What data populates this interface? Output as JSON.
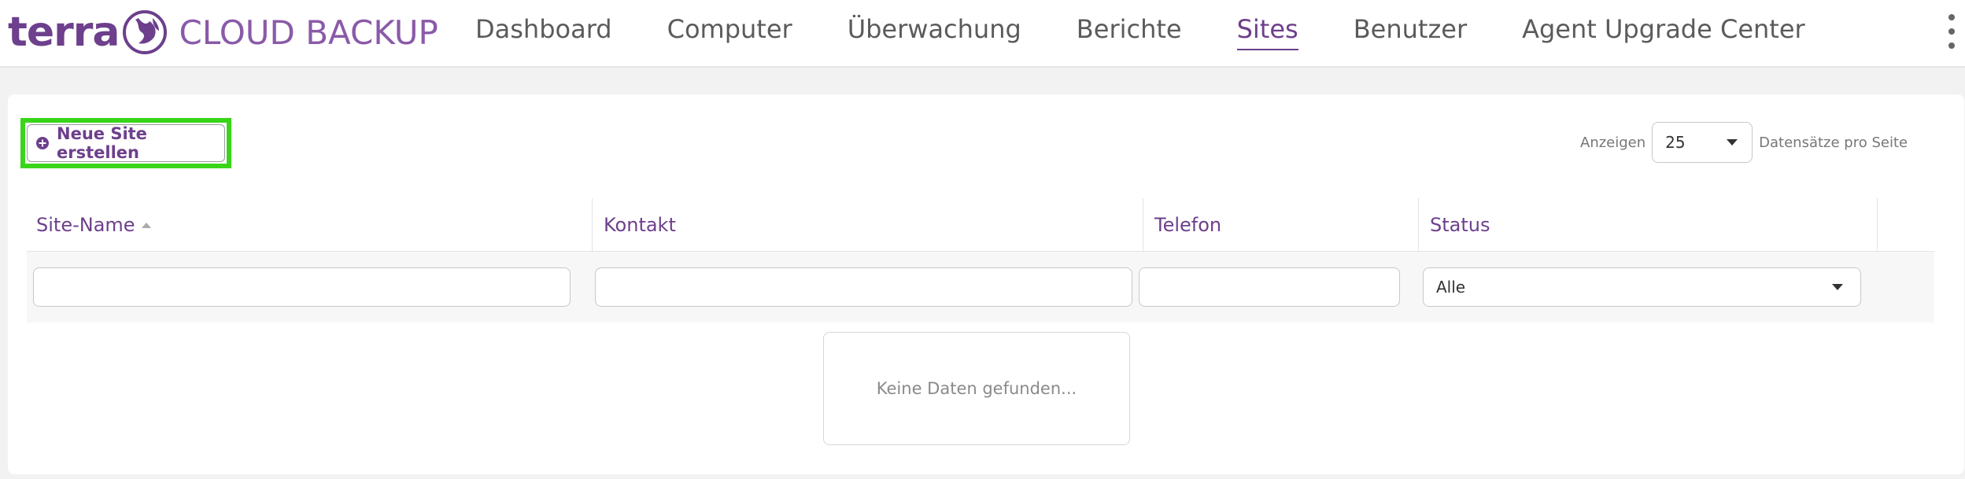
{
  "brand": {
    "logo_word": "terra",
    "product": "CLOUD BACKUP",
    "primary_color": "#6d3f8c",
    "highlight_color": "#39d51a"
  },
  "nav": {
    "items": [
      {
        "label": "Dashboard",
        "active": false
      },
      {
        "label": "Computer",
        "active": false
      },
      {
        "label": "Überwachung",
        "active": false
      },
      {
        "label": "Berichte",
        "active": false
      },
      {
        "label": "Sites",
        "active": true
      },
      {
        "label": "Benutzer",
        "active": false
      },
      {
        "label": "Agent Upgrade Center",
        "active": false
      }
    ],
    "menu_icon": "kebab-menu-icon"
  },
  "toolbar": {
    "new_site_label": "Neue Site erstellen",
    "new_site_icon": "plus-circle-icon"
  },
  "pager": {
    "show_label": "Anzeigen",
    "page_size": "25",
    "per_page_label": "Datensätze pro Seite"
  },
  "table": {
    "columns": [
      {
        "label": "Site-Name",
        "sorted": "asc"
      },
      {
        "label": "Kontakt"
      },
      {
        "label": "Telefon"
      },
      {
        "label": "Status"
      }
    ],
    "filters": {
      "site_name": "",
      "contact": "",
      "phone": "",
      "status": "Alle"
    },
    "empty_message": "Keine Daten gefunden..."
  }
}
